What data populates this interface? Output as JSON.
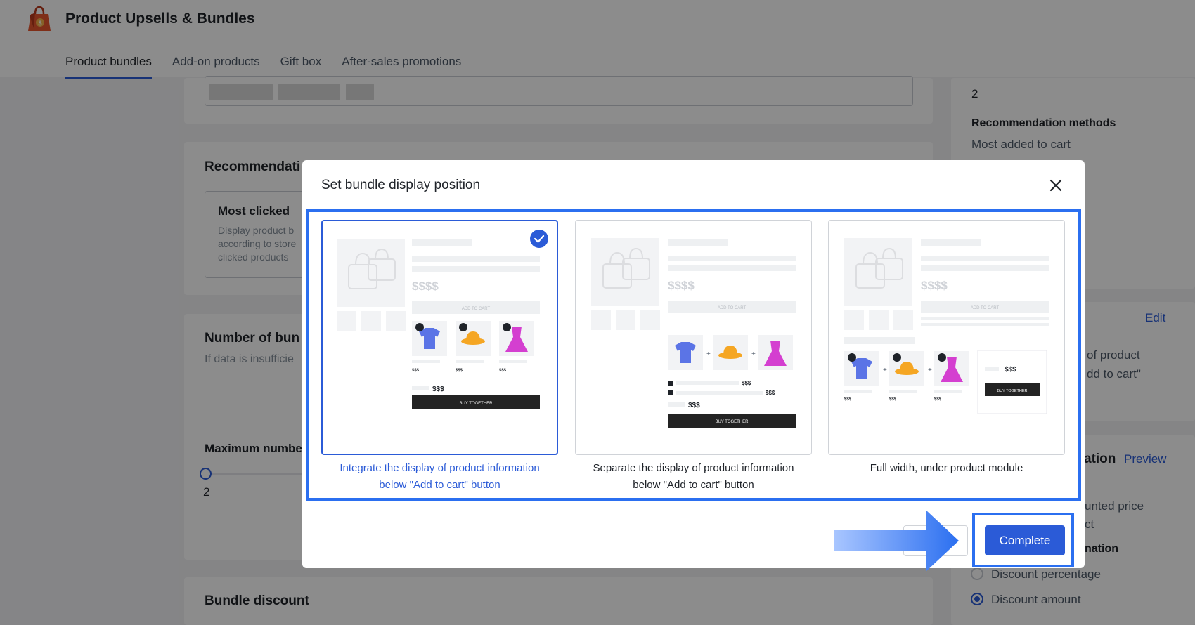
{
  "app": {
    "title": "Product Upsells & Bundles"
  },
  "tabs": [
    {
      "label": "Product bundles",
      "active": true
    },
    {
      "label": "Add-on products",
      "active": false
    },
    {
      "label": "Gift box",
      "active": false
    },
    {
      "label": "After-sales promotions",
      "active": false
    }
  ],
  "background": {
    "recommendation": {
      "title": "Recommendati",
      "option_title": "Most clicked",
      "option_desc_lines": [
        "Display product b",
        "according to store",
        "clicked products"
      ]
    },
    "number": {
      "title": "Number of bun",
      "desc": "If data is insufficie",
      "max_label": "Maximum numbe",
      "slider_value": "2"
    },
    "discount": {
      "title": "Bundle discount"
    },
    "sidebar": {
      "count_value": "2",
      "rec_methods_label": "Recommendation methods",
      "rec_methods_value": "Most added to cart",
      "edit_link": "Edit",
      "pos_line1": "of product",
      "pos_line2": "dd to cart\"",
      "ation_label": "ation",
      "preview_link": "Preview",
      "unted_price": "unted price",
      "ct": "ct",
      "nation": "nation",
      "discount_percentage": "Discount percentage",
      "discount_amount": "Discount amount"
    }
  },
  "modal": {
    "title": "Set bundle display position",
    "choices": [
      {
        "label_line1": "Integrate the display of product information",
        "label_line2": "below \"Add to cart\" button",
        "selected": true
      },
      {
        "label_line1": "Separate the display of product information",
        "label_line2": "below \"Add to cart\" button",
        "selected": false
      },
      {
        "label_line1": "Full width, under product module",
        "label_line2": "",
        "selected": false
      }
    ],
    "illustration": {
      "price_big": "$$$$",
      "add_to_cart": "ADD TO CART",
      "item_price": "$$$",
      "bundle_price": "$$$",
      "buy_together": "BUY TOGETHER",
      "plus": "+"
    },
    "complete_label": "Complete"
  },
  "colors": {
    "accent": "#2b5bd7",
    "highlight": "#2b6ff0"
  }
}
